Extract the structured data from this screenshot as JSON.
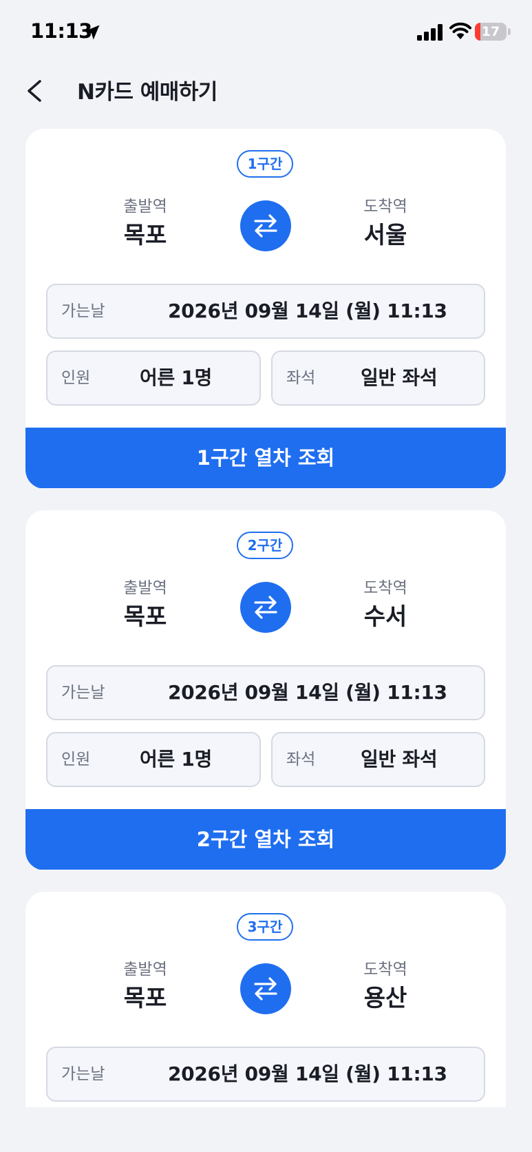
{
  "status_bar": {
    "time": "11:13",
    "battery_level": "17",
    "battery_fraction": 0.17,
    "icons": [
      "location-arrow-icon",
      "signal-icon",
      "wifi-icon",
      "battery-icon"
    ]
  },
  "header": {
    "back_icon": "chevron-left-icon",
    "title": "N카드 예매하기"
  },
  "colors": {
    "accent": "#1f6ef0",
    "background": "#f2f3f7",
    "card": "#ffffff",
    "field_bg": "#f4f6fb",
    "battery_low": "#ff3b30"
  },
  "sections": [
    {
      "badge": "1구간",
      "departure_label": "출발역",
      "departure": "목포",
      "arrival_label": "도착역",
      "arrival": "서울",
      "date_label": "가는날",
      "date_value": "2026년 09월 14일 (월) 11:13",
      "pax_label": "인원",
      "pax_value": "어른 1명",
      "seat_label": "좌석",
      "seat_value": "일반 좌석",
      "button_label": "1구간 열차 조회"
    },
    {
      "badge": "2구간",
      "departure_label": "출발역",
      "departure": "목포",
      "arrival_label": "도착역",
      "arrival": "수서",
      "date_label": "가는날",
      "date_value": "2026년 09월 14일 (월) 11:13",
      "pax_label": "인원",
      "pax_value": "어른 1명",
      "seat_label": "좌석",
      "seat_value": "일반 좌석",
      "button_label": "2구간 열차 조회"
    },
    {
      "badge": "3구간",
      "departure_label": "출발역",
      "departure": "목포",
      "arrival_label": "도착역",
      "arrival": "용산",
      "date_label": "가는날",
      "date_value": "2026년 09월 14일 (월) 11:13"
    }
  ]
}
